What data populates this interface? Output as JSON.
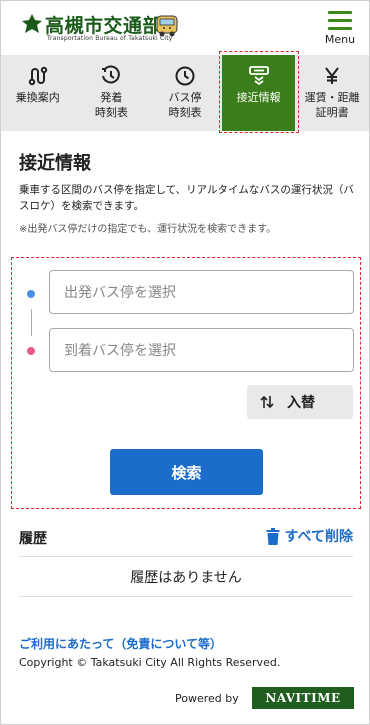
{
  "header": {
    "logo_title": "高槻市交通部",
    "logo_subtitle": "Transportation Bureau of Takatsuki City",
    "menu_label": "Menu"
  },
  "tabs": [
    {
      "label": "乗換案内",
      "icon": "route-icon",
      "active": false
    },
    {
      "label": "発着\n時刻表",
      "icon": "timetable-icon",
      "active": false
    },
    {
      "label": "バス停\n時刻表",
      "icon": "clock-icon",
      "active": false
    },
    {
      "label": "接近情報",
      "icon": "bus-approach-icon",
      "active": true
    },
    {
      "label": "運賃・距離\n証明書",
      "icon": "yen-icon",
      "active": false
    }
  ],
  "main": {
    "title": "接近情報",
    "description": "乗車する区間のバス停を指定して、リアルタイムなバスの運行状況（バスロケ）を検索できます。",
    "note": "※出発バス停だけの指定でも、運行状況を検索できます。",
    "from_placeholder": "出発バス停を選択",
    "to_placeholder": "到着バス停を選択",
    "swap_label": "入替",
    "search_label": "検索"
  },
  "history": {
    "title": "履歴",
    "delete_all_label": "すべて削除",
    "empty_text": "履歴はありません"
  },
  "footer": {
    "terms_link": "ご利用にあたって（免責について等）",
    "copyright": "Copyright © Takatsuki City All Rights Reserved.",
    "powered_by": "Powered by",
    "navitime_logo": "NAVITIME"
  },
  "colors": {
    "brand_green": "#3a7d1a",
    "link_blue": "#1c6cc9",
    "from_dot": "#4a8fe0",
    "to_dot": "#e95a86",
    "highlight_red": "#e0242c"
  }
}
